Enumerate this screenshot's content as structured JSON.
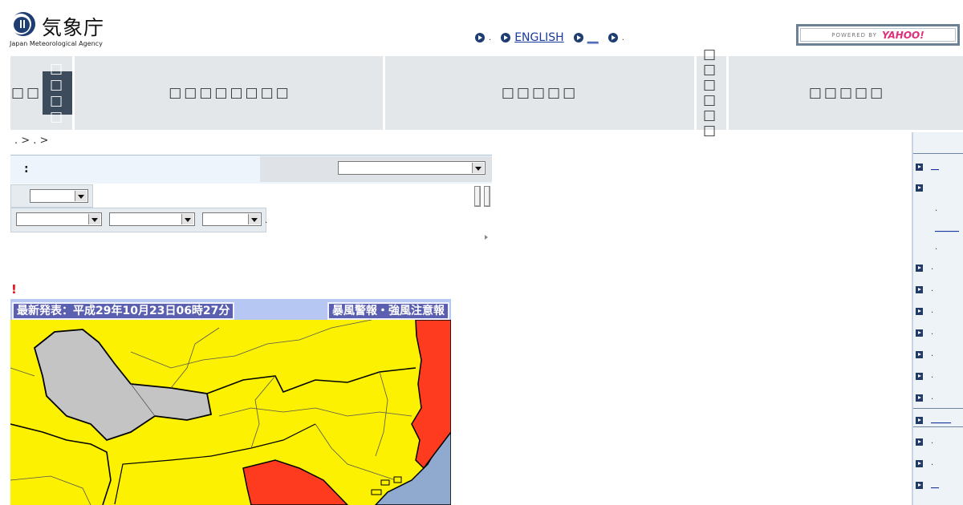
{
  "header": {
    "logo_jp": "気象庁",
    "logo_en": "Japan Meteorological Agency",
    "links": [
      {
        "label": ".",
        "kind": "punct"
      },
      {
        "label": "ENGLISH",
        "kind": "link"
      },
      {
        "label": "__",
        "kind": "link"
      },
      {
        "label": ".",
        "kind": "punct"
      }
    ],
    "search_powered": "POWERED BY",
    "search_brand": "YAHOO!"
  },
  "nav": {
    "items": [
      {
        "label": "□□"
      },
      {
        "label": "□□□□"
      },
      {
        "label": "□□□□□□□□"
      },
      {
        "label": "□□□□□"
      },
      {
        "label": "□□□□□□"
      },
      {
        "label": "□□□□□"
      }
    ]
  },
  "breadcrumb": ". > . >",
  "form": {
    "row1_label": ":",
    "select_main": "",
    "select_small": "",
    "selects_row3": [
      "",
      "",
      ""
    ],
    "trail": "."
  },
  "notice_mark": "!",
  "map": {
    "latest_label": "最新発表：平成29年10月23日06時27分",
    "type_label": "暴風警報・強風注意報",
    "colors": {
      "warning": "#ff3b1f",
      "advisory": "#fbf100",
      "none": "#c4c4c4",
      "sea": "#8fa9cf"
    }
  },
  "sidebar": {
    "items": [
      {
        "label": "__",
        "link": true
      },
      {
        "label": "",
        "link": false
      },
      {
        "label": ".",
        "link": false
      },
      {
        "label": "______",
        "link": true
      },
      {
        "label": ".",
        "link": false
      },
      {
        "label": ".",
        "link": false
      },
      {
        "label": ".",
        "link": false
      },
      {
        "label": ".",
        "link": false
      },
      {
        "label": ".",
        "link": false
      },
      {
        "label": ".",
        "link": false
      },
      {
        "label": ".",
        "link": false
      },
      {
        "label": ".",
        "link": false
      },
      {
        "label": "_____",
        "link": true
      },
      {
        "label": ".",
        "link": false
      },
      {
        "label": ".",
        "link": false
      },
      {
        "label": "__",
        "link": true
      }
    ]
  }
}
